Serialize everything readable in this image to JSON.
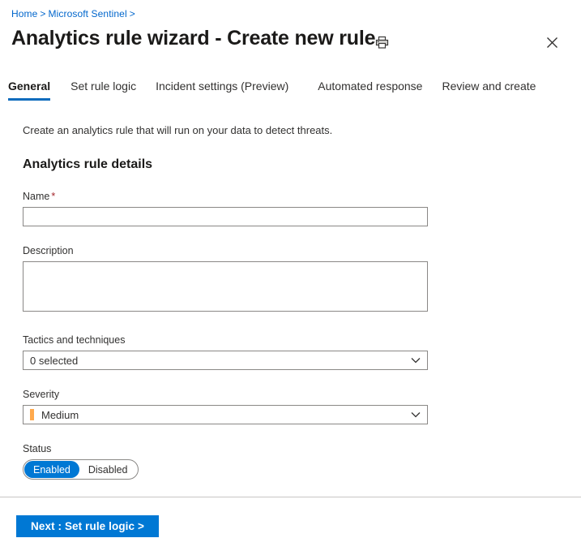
{
  "breadcrumb": {
    "items": [
      "Home",
      "Microsoft Sentinel"
    ],
    "separator": ">",
    "trailing_separator": ">"
  },
  "header": {
    "title": "Analytics rule wizard - Create new rule",
    "print_icon": "print-icon",
    "close_icon": "close-icon"
  },
  "tabs": [
    {
      "label": "General",
      "selected": true
    },
    {
      "label": "Set rule logic",
      "selected": false
    },
    {
      "label": "Incident settings (Preview)",
      "selected": false
    },
    {
      "label": "Automated response",
      "selected": false
    },
    {
      "label": "Review and create",
      "selected": false
    }
  ],
  "main": {
    "intro_text": "Create an analytics rule that will run on your data to detect threats.",
    "section_heading": "Analytics rule details",
    "fields": {
      "name": {
        "label": "Name",
        "required_marker": "*",
        "value": "",
        "placeholder": ""
      },
      "description": {
        "label": "Description",
        "value": "",
        "placeholder": ""
      },
      "tactics": {
        "label": "Tactics and techniques",
        "value": "0 selected",
        "chevron_icon": "chevron-down-icon"
      },
      "severity": {
        "label": "Severity",
        "value": "Medium",
        "swatch_color": "#ffa94d",
        "chevron_icon": "chevron-down-icon"
      },
      "status": {
        "label": "Status",
        "options": [
          "Enabled",
          "Disabled"
        ],
        "selected": "Enabled"
      }
    }
  },
  "footer": {
    "next_label": "Next : Set rule logic >"
  },
  "colors": {
    "accent": "#0078d4",
    "tab_underline": "#0f6cbd",
    "link": "#0066cc",
    "required": "#a4262c",
    "severity_medium": "#ffa94d",
    "border": "#8a8886",
    "divider": "#c8c6c4"
  }
}
